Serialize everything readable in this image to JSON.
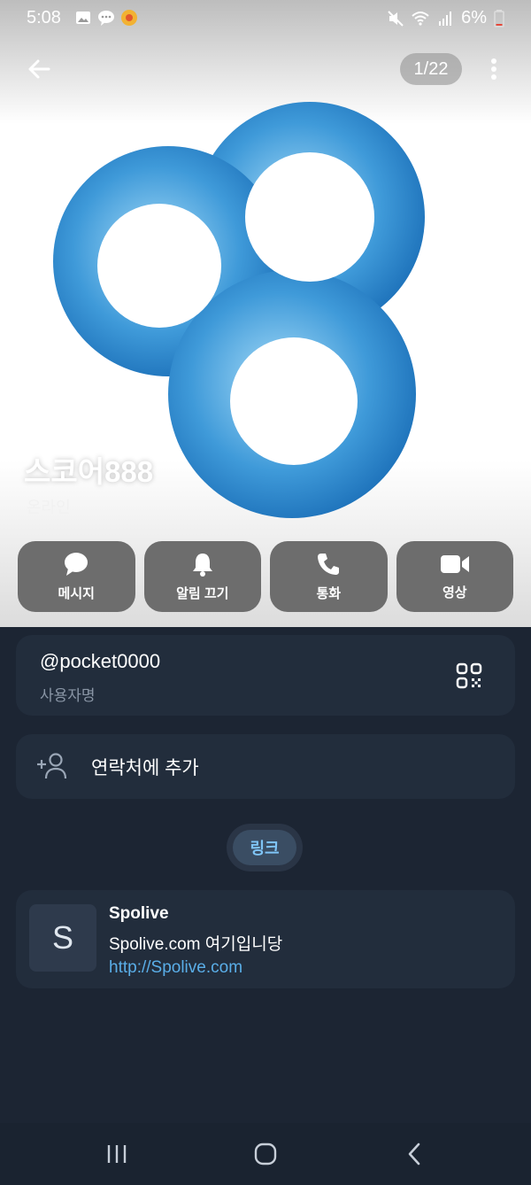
{
  "status_bar": {
    "time": "5:08",
    "battery": "6%"
  },
  "header": {
    "counter": "1/22"
  },
  "profile": {
    "name": "스코어888",
    "status": "온라인"
  },
  "actions": [
    {
      "label": "메시지",
      "icon": "message-icon"
    },
    {
      "label": "알림 끄기",
      "icon": "bell-icon"
    },
    {
      "label": "통화",
      "icon": "phone-icon"
    },
    {
      "label": "영상",
      "icon": "video-icon"
    }
  ],
  "username": {
    "value": "@pocket0000",
    "caption": "사용자명"
  },
  "add_contact": {
    "label": "연락처에 추가"
  },
  "section_chip": {
    "label": "링크"
  },
  "link": {
    "thumb_letter": "S",
    "title": "Spolive",
    "description": "Spolive.com 여기입니당",
    "url": "http://Spolive.com"
  },
  "colors": {
    "background": "#1c2533",
    "card": "#222d3c",
    "accent": "#5aaee8",
    "logo_blue": "#3a95d8"
  }
}
